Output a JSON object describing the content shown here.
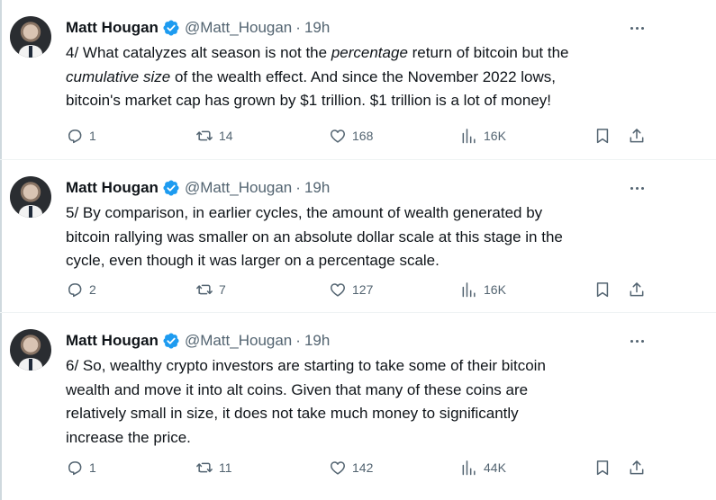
{
  "author": {
    "name": "Matt Hougan",
    "handle": "@Matt_Hougan",
    "separator": "·"
  },
  "colors": {
    "text": "#0f1419",
    "muted": "#536471",
    "verified_badge": "#1d9bf0",
    "divider": "#eff3f4"
  },
  "tweets": [
    {
      "time": "19h",
      "text_parts": [
        "4/ What catalyzes alt season is not the ",
        "percentage",
        " return of bitcoin but the",
        "cumulative size",
        " of the wealth effect. And since the November 2022 lows,",
        "bitcoin's market cap has grown by $1 trillion. $1 trillion is a lot of money!"
      ],
      "replies": "1",
      "retweets": "14",
      "likes": "168",
      "views": "16K"
    },
    {
      "time": "19h",
      "lines": [
        "5/ By comparison, in earlier cycles, the amount of wealth generated by",
        "bitcoin rallying was smaller on an absolute dollar scale at this stage in the",
        "cycle, even though it was larger on a percentage scale."
      ],
      "replies": "2",
      "retweets": "7",
      "likes": "127",
      "views": "16K"
    },
    {
      "time": "19h",
      "lines": [
        "6/ So, wealthy crypto investors are starting to take some of their bitcoin",
        "wealth and move it into alt coins. Given that many of these coins are",
        "relatively small in size, it does not take much money to significantly",
        "increase the price."
      ],
      "replies": "1",
      "retweets": "11",
      "likes": "142",
      "views": "44K"
    }
  ],
  "icons": {
    "reply": "reply-icon",
    "retweet": "retweet-icon",
    "like": "heart-icon",
    "views": "views-chart-icon",
    "bookmark": "bookmark-icon",
    "share": "share-icon",
    "more": "more-options-icon",
    "verified": "verified-badge-icon"
  }
}
